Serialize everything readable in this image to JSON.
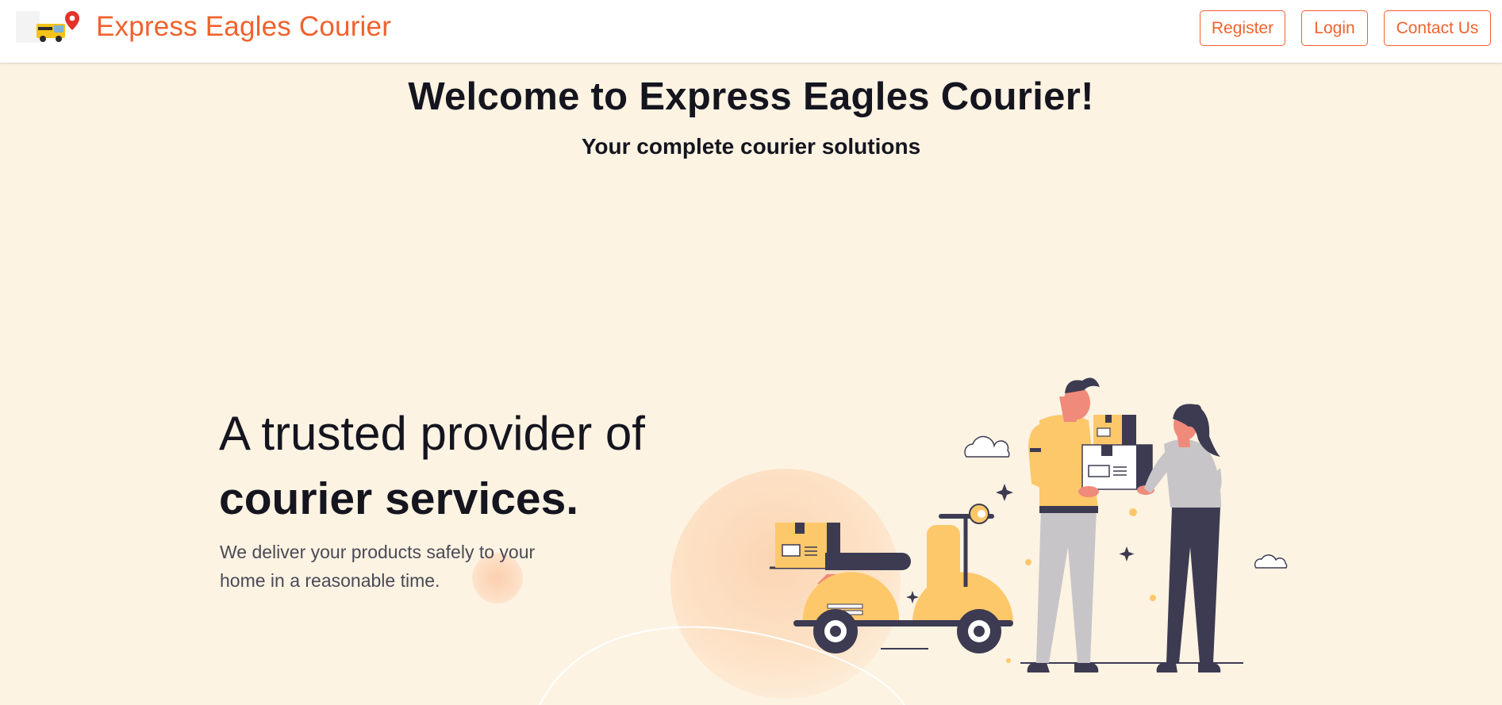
{
  "header": {
    "brand": "Express Eagles Courier",
    "nav": {
      "register": "Register",
      "login": "Login",
      "contact": "Contact Us"
    }
  },
  "hero": {
    "title": "Welcome to Express Eagles Courier!",
    "subtitle": "Your complete courier solutions"
  },
  "tagline": {
    "line1": "A trusted provider of",
    "line2": "courier services.",
    "description": "We deliver your products safely to your home in a reasonable time."
  },
  "colors": {
    "accent": "#f0622e",
    "background": "#fdf3e3",
    "text": "#15151f",
    "illustration_yellow": "#fdc86a",
    "illustration_dark": "#3c3b52"
  }
}
